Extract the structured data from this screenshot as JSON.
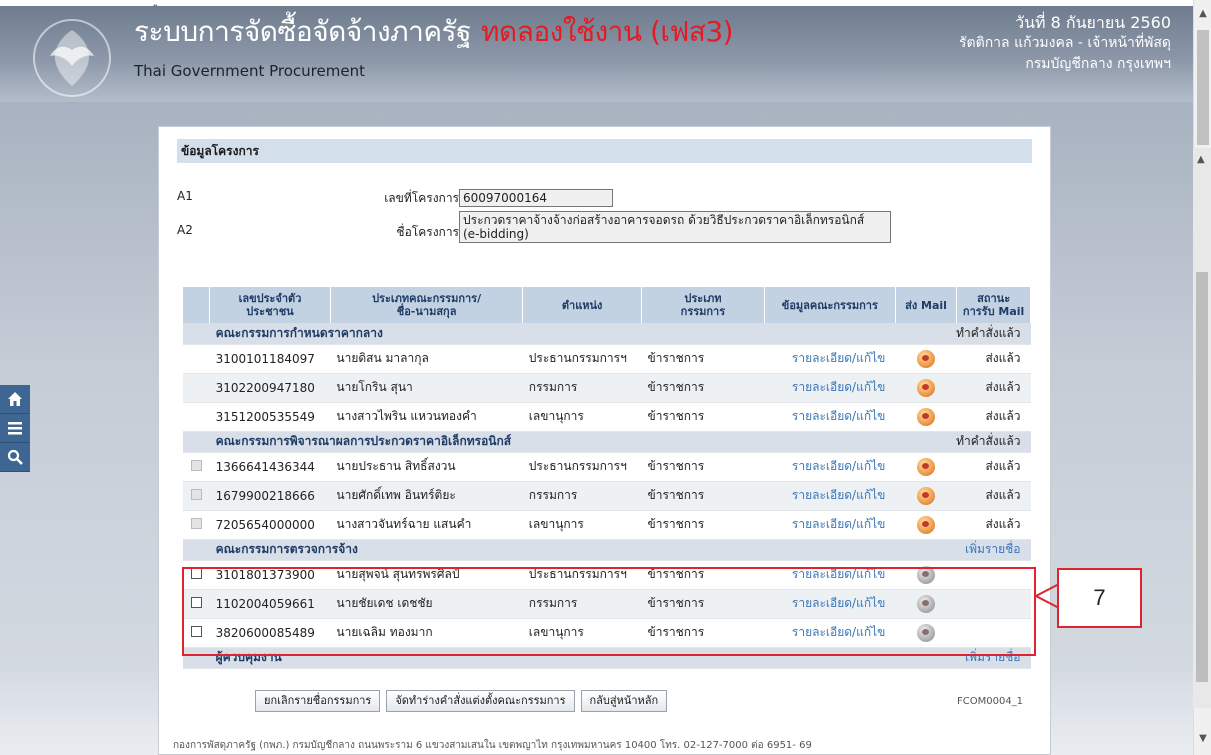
{
  "top_fragment": "ู",
  "header": {
    "title": "ระบบการจัดซื้อจัดจ้างภาครัฐ",
    "trial_label": "ทดลองใช้งาน (เฟส3)",
    "subtitle": "Thai Government Procurement",
    "date": "วันที่ 8 กันยายน 2560",
    "user": "รัตติกาล แก้วมงคล - เจ้าหน้าที่พัสดุ",
    "org": "กรมบัญชีกลาง กรุงเทพฯ"
  },
  "project": {
    "section_title": "ข้อมูลโครงการ",
    "rows": [
      {
        "code": "A1",
        "label": "เลขที่โครงการ",
        "value": "60097000164"
      },
      {
        "code": "A2",
        "label": "ชื่อโครงการ",
        "value_line1": "ประกวดราคาจ้างจ้างก่อสร้างอาคารจอดรถ ด้วยวิธีประกวดราคาอิเล็กทรอนิกส์",
        "value_line2": "(e-bidding)"
      }
    ]
  },
  "table": {
    "headers": {
      "id": [
        "เลขประจำตัว",
        "ประชาชน"
      ],
      "type_name": [
        "ประเภทคณะกรรมการ/",
        "ชื่อ-นามสกุล"
      ],
      "position": "ตำแหน่ง",
      "committee_type": [
        "ประเภท",
        "กรรมการ"
      ],
      "info": "ข้อมูลคณะกรรมการ",
      "send_mail": "ส่ง Mail",
      "status": [
        "สถานะ",
        "การรับ Mail"
      ]
    },
    "groups": [
      {
        "name": "คณะกรรมการกำหนดราคากลาง",
        "action": "ทำคำสั่งแล้ว",
        "members": [
          {
            "id": "3100101184097",
            "name": "นายดิสน มาลากุล",
            "position": "ประธานกรรมการฯ",
            "type": "ข้าราชการ",
            "detail": "รายละเอียด/แก้ไข",
            "status": "ส่งแล้ว"
          },
          {
            "id": "3102200947180",
            "name": "นายโกริน สุนา",
            "position": "กรรมการ",
            "type": "ข้าราชการ",
            "detail": "รายละเอียด/แก้ไข",
            "status": "ส่งแล้ว"
          },
          {
            "id": "3151200535549",
            "name": "นางสาวไพริน แหวนทองคำ",
            "position": "เลขานุการ",
            "type": "ข้าราชการ",
            "detail": "รายละเอียด/แก้ไข",
            "status": "ส่งแล้ว"
          }
        ]
      },
      {
        "name": "คณะกรรมการพิจารณาผลการประกวดราคาอิเล็กทรอนิกส์",
        "action": "ทำคำสั่งแล้ว",
        "members": [
          {
            "id": "1366641436344",
            "name": "นายประธาน สิทธิ์สงวน",
            "position": "ประธานกรรมการฯ",
            "type": "ข้าราชการ",
            "detail": "รายละเอียด/แก้ไข",
            "status": "ส่งแล้ว"
          },
          {
            "id": "1679900218666",
            "name": "นายศักดิ์เทพ อินทร์ติยะ",
            "position": "กรรมการ",
            "type": "ข้าราชการ",
            "detail": "รายละเอียด/แก้ไข",
            "status": "ส่งแล้ว"
          },
          {
            "id": "7205654000000",
            "name": "นางสาวจันทร์ฉาย แสนคำ",
            "position": "เลขานุการ",
            "type": "ข้าราชการ",
            "detail": "รายละเอียด/แก้ไข",
            "status": "ส่งแล้ว"
          }
        ]
      },
      {
        "name": "คณะกรรมการตรวจการจ้าง",
        "action": "เพิ่มรายชื่อ",
        "members": [
          {
            "id": "3101801373900",
            "name": "นายสุพจน์ สุนทรพรศิลป์",
            "position": "ประธานกรรมการฯ",
            "type": "ข้าราชการ",
            "detail": "รายละเอียด/แก้ไข",
            "status": ""
          },
          {
            "id": "1102004059661",
            "name": "นายชัยเดช เดชชัย",
            "position": "กรรมการ",
            "type": "ข้าราชการ",
            "detail": "รายละเอียด/แก้ไข",
            "status": ""
          },
          {
            "id": "3820600085489",
            "name": "นายเฉลิม ทองมาก",
            "position": "เลขานุการ",
            "type": "ข้าราชการ",
            "detail": "รายละเอียด/แก้ไข",
            "status": ""
          }
        ]
      },
      {
        "name": "ผู้ควบคุมงาน",
        "action": "เพิ่มรายชื่อ",
        "members": []
      }
    ]
  },
  "buttons": {
    "cancel": "ยกเลิกรายชื่อกรรมการ",
    "draft": "จัดทำร่างคำสั่งแต่งตั้งคณะกรรมการ",
    "home": "กลับสู่หน้าหลัก"
  },
  "form_code": "FCOM0004_1",
  "footer": "กองการพัสดุภาครัฐ (กพภ.) กรมบัญชีกลาง ถนนพระราม 6 แขวงสามเสนใน เขตพญาไท กรุงเทพมหานคร 10400 โทร. 02-127-7000 ต่อ 6951- 69",
  "callout_number": "7",
  "side_icons": [
    "home-icon",
    "menu-icon",
    "search-icon"
  ],
  "colors": {
    "trial_red": "#e31b23",
    "link_blue": "#3b76b8",
    "header_text": "#1f3c66",
    "highlight_red": "#e0242f"
  }
}
